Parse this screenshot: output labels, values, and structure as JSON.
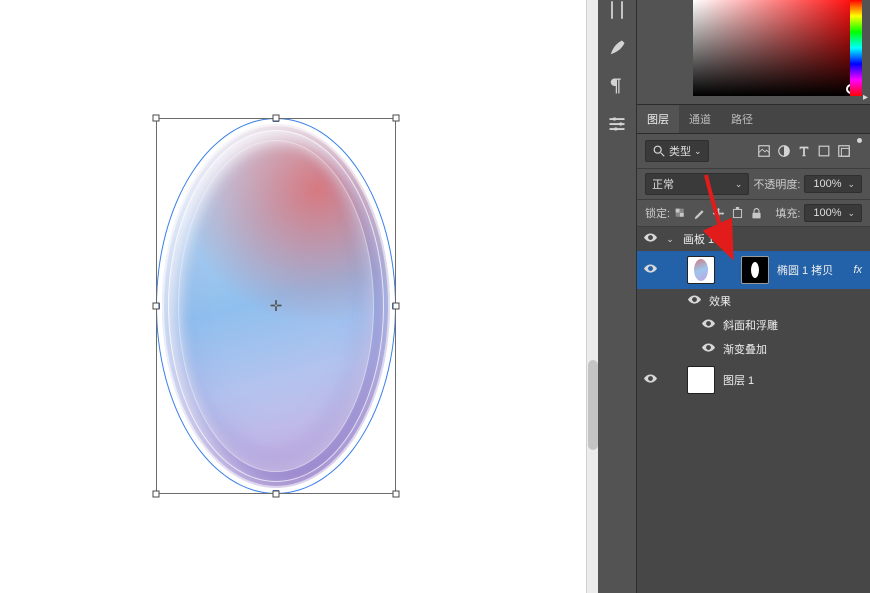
{
  "tabs": {
    "layers": "图层",
    "channels": "通道",
    "paths": "路径"
  },
  "filter": {
    "label": "类型"
  },
  "blend": {
    "mode": "正常",
    "opacity_label": "不透明度:",
    "opacity_value": "100%"
  },
  "lock": {
    "label": "锁定:",
    "fill_label": "填充:",
    "fill_value": "100%"
  },
  "artboard": {
    "name": "画板 1"
  },
  "layer_ellipse": {
    "name": "椭圆 1 拷贝",
    "fx": "fx"
  },
  "effects": {
    "label": "效果",
    "bevel": "斜面和浮雕",
    "gradient": "渐变叠加"
  },
  "layer_bg": {
    "name": "图层 1"
  }
}
